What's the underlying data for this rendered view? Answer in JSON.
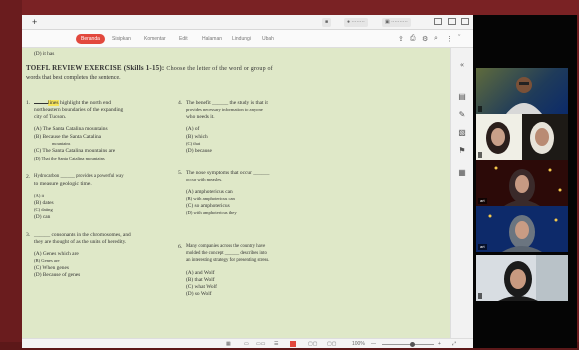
{
  "toolbar": {
    "tabs": [
      "Beranda",
      "Sisipkan",
      "Komentar",
      "Edit",
      "Halaman",
      "Lindungi",
      "Ubah"
    ],
    "active_tab": "Beranda"
  },
  "page": {
    "top_line": "(D) it has",
    "heading_bold": "TOEFL REVIEW EXERCISE (Skills 1-15):",
    "heading_rest": "Choose the letter of the word or group of",
    "heading_line2": "words that best completes the sentence.",
    "q1_num": "1.",
    "q1_line1_highlight": "lines",
    "q1_line1_rest": "highlight the north end",
    "q1_line2": "northeastern boundaries of the expanding",
    "q1_line3": "city of Tucson.",
    "q1_a": "(A)  The Santa Catalina mountains",
    "q1_b": "(B)  Because the Santa Catalina",
    "q1_b2": "mountains",
    "q1_c": "(C)  The Santa Catalina mountains are",
    "q1_d": "(D)  That the Santa Catalina mountains",
    "q2_num": "2.",
    "q2_line1": "Hydrocarbon ______ provides a powerful way",
    "q2_line2": "to measure geologic time.",
    "q2_a": "(A)  it",
    "q2_b": "(B)  dates",
    "q2_c": "(C)  dating",
    "q2_d": "(D)  can",
    "q3_num": "3.",
    "q3_line1": "______ consonants in the chromosomes, and",
    "q3_line2": "they are thought of as the units of heredity.",
    "q3_a": "(A)  Genes which are",
    "q3_b": "(B)  Genes are",
    "q3_c": "(C)  When genes",
    "q3_d": "(D)  Because of genes",
    "q4_num": "4.",
    "q4_line1": "The benefit ______ the study is that it",
    "q4_line2": "provides necessary information to anyone",
    "q4_line3": "who needs it.",
    "q4_a": "(A)  of",
    "q4_b": "(B)  which",
    "q4_c": "(C)  that",
    "q4_d": "(D)  because",
    "q5_num": "5.",
    "q5_line1": "The nose symptoms that occur ______",
    "q5_line2": "occur with measles.",
    "q5_a": "(A)  amphotericus can",
    "q5_b": "(B)  with amphotericus can",
    "q5_c": "(C)  so amphotericus",
    "q5_d": "(D)  with amphotericus they",
    "q6_num": "6.",
    "q6_line1": "Many companies across the country have",
    "q6_line2": "molded the concept ______ describes into",
    "q6_line3": "an interesting strategy for presenting stress.",
    "q6_a": "(A)  and Wolf",
    "q6_b": "(B)  that Wolf",
    "q6_c": "(C)  what Wolf",
    "q6_d": "(D)  so Wolf"
  },
  "statusbar": {
    "zoom": "100%",
    "zoom_minus": "—",
    "zoom_plus": "+"
  },
  "videos": {
    "participants": [
      "",
      "",
      "art",
      "art",
      ""
    ]
  },
  "colors": {
    "accent": "#e2483d",
    "page_tint": "#dfe8c8",
    "highlight": "#f5e35a",
    "frame": "#6e1d1f"
  }
}
